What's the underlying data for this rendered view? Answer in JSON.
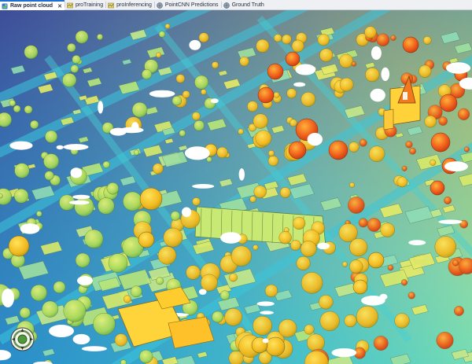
{
  "tabs": [
    {
      "label": "Raw point cloud",
      "active": true,
      "icon": "scene-icon",
      "closable": true
    },
    {
      "label": "proTraining",
      "active": false,
      "icon": "map-icon",
      "closable": false
    },
    {
      "label": "proInferencing",
      "active": false,
      "icon": "map-icon",
      "closable": false
    },
    {
      "label": "PointCNN Predictions",
      "active": false,
      "icon": "globe-scene-icon",
      "closable": false
    },
    {
      "label": "Ground Truth",
      "active": false,
      "icon": "globe-scene-icon",
      "closable": false
    }
  ],
  "close_glyph": "✕",
  "scene": {
    "kind": "lidar point cloud, elevation colored",
    "palette": [
      "#2b1d8f",
      "#2f6fd6",
      "#27c3d8",
      "#6fe0b0",
      "#c9e86a",
      "#ffd23a",
      "#ff8a1c",
      "#e8471a"
    ]
  },
  "navigator": {
    "icon": "navigator-icon"
  }
}
